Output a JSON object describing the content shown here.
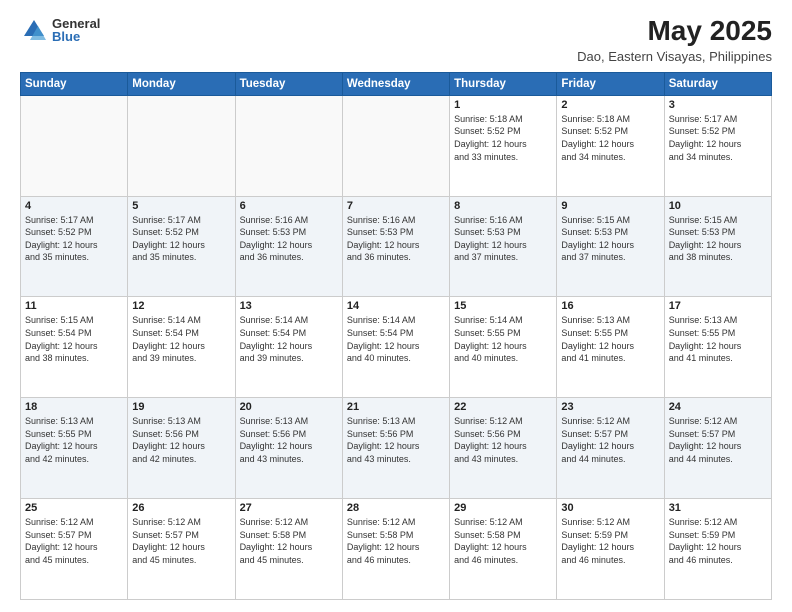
{
  "header": {
    "logo_general": "General",
    "logo_blue": "Blue",
    "title": "May 2025",
    "subtitle": "Dao, Eastern Visayas, Philippines"
  },
  "days_of_week": [
    "Sunday",
    "Monday",
    "Tuesday",
    "Wednesday",
    "Thursday",
    "Friday",
    "Saturday"
  ],
  "weeks": [
    [
      {
        "day": "",
        "info": ""
      },
      {
        "day": "",
        "info": ""
      },
      {
        "day": "",
        "info": ""
      },
      {
        "day": "",
        "info": ""
      },
      {
        "day": "1",
        "info": "Sunrise: 5:18 AM\nSunset: 5:52 PM\nDaylight: 12 hours\nand 33 minutes."
      },
      {
        "day": "2",
        "info": "Sunrise: 5:18 AM\nSunset: 5:52 PM\nDaylight: 12 hours\nand 34 minutes."
      },
      {
        "day": "3",
        "info": "Sunrise: 5:17 AM\nSunset: 5:52 PM\nDaylight: 12 hours\nand 34 minutes."
      }
    ],
    [
      {
        "day": "4",
        "info": "Sunrise: 5:17 AM\nSunset: 5:52 PM\nDaylight: 12 hours\nand 35 minutes."
      },
      {
        "day": "5",
        "info": "Sunrise: 5:17 AM\nSunset: 5:52 PM\nDaylight: 12 hours\nand 35 minutes."
      },
      {
        "day": "6",
        "info": "Sunrise: 5:16 AM\nSunset: 5:53 PM\nDaylight: 12 hours\nand 36 minutes."
      },
      {
        "day": "7",
        "info": "Sunrise: 5:16 AM\nSunset: 5:53 PM\nDaylight: 12 hours\nand 36 minutes."
      },
      {
        "day": "8",
        "info": "Sunrise: 5:16 AM\nSunset: 5:53 PM\nDaylight: 12 hours\nand 37 minutes."
      },
      {
        "day": "9",
        "info": "Sunrise: 5:15 AM\nSunset: 5:53 PM\nDaylight: 12 hours\nand 37 minutes."
      },
      {
        "day": "10",
        "info": "Sunrise: 5:15 AM\nSunset: 5:53 PM\nDaylight: 12 hours\nand 38 minutes."
      }
    ],
    [
      {
        "day": "11",
        "info": "Sunrise: 5:15 AM\nSunset: 5:54 PM\nDaylight: 12 hours\nand 38 minutes."
      },
      {
        "day": "12",
        "info": "Sunrise: 5:14 AM\nSunset: 5:54 PM\nDaylight: 12 hours\nand 39 minutes."
      },
      {
        "day": "13",
        "info": "Sunrise: 5:14 AM\nSunset: 5:54 PM\nDaylight: 12 hours\nand 39 minutes."
      },
      {
        "day": "14",
        "info": "Sunrise: 5:14 AM\nSunset: 5:54 PM\nDaylight: 12 hours\nand 40 minutes."
      },
      {
        "day": "15",
        "info": "Sunrise: 5:14 AM\nSunset: 5:55 PM\nDaylight: 12 hours\nand 40 minutes."
      },
      {
        "day": "16",
        "info": "Sunrise: 5:13 AM\nSunset: 5:55 PM\nDaylight: 12 hours\nand 41 minutes."
      },
      {
        "day": "17",
        "info": "Sunrise: 5:13 AM\nSunset: 5:55 PM\nDaylight: 12 hours\nand 41 minutes."
      }
    ],
    [
      {
        "day": "18",
        "info": "Sunrise: 5:13 AM\nSunset: 5:55 PM\nDaylight: 12 hours\nand 42 minutes."
      },
      {
        "day": "19",
        "info": "Sunrise: 5:13 AM\nSunset: 5:56 PM\nDaylight: 12 hours\nand 42 minutes."
      },
      {
        "day": "20",
        "info": "Sunrise: 5:13 AM\nSunset: 5:56 PM\nDaylight: 12 hours\nand 43 minutes."
      },
      {
        "day": "21",
        "info": "Sunrise: 5:13 AM\nSunset: 5:56 PM\nDaylight: 12 hours\nand 43 minutes."
      },
      {
        "day": "22",
        "info": "Sunrise: 5:12 AM\nSunset: 5:56 PM\nDaylight: 12 hours\nand 43 minutes."
      },
      {
        "day": "23",
        "info": "Sunrise: 5:12 AM\nSunset: 5:57 PM\nDaylight: 12 hours\nand 44 minutes."
      },
      {
        "day": "24",
        "info": "Sunrise: 5:12 AM\nSunset: 5:57 PM\nDaylight: 12 hours\nand 44 minutes."
      }
    ],
    [
      {
        "day": "25",
        "info": "Sunrise: 5:12 AM\nSunset: 5:57 PM\nDaylight: 12 hours\nand 45 minutes."
      },
      {
        "day": "26",
        "info": "Sunrise: 5:12 AM\nSunset: 5:57 PM\nDaylight: 12 hours\nand 45 minutes."
      },
      {
        "day": "27",
        "info": "Sunrise: 5:12 AM\nSunset: 5:58 PM\nDaylight: 12 hours\nand 45 minutes."
      },
      {
        "day": "28",
        "info": "Sunrise: 5:12 AM\nSunset: 5:58 PM\nDaylight: 12 hours\nand 46 minutes."
      },
      {
        "day": "29",
        "info": "Sunrise: 5:12 AM\nSunset: 5:58 PM\nDaylight: 12 hours\nand 46 minutes."
      },
      {
        "day": "30",
        "info": "Sunrise: 5:12 AM\nSunset: 5:59 PM\nDaylight: 12 hours\nand 46 minutes."
      },
      {
        "day": "31",
        "info": "Sunrise: 5:12 AM\nSunset: 5:59 PM\nDaylight: 12 hours\nand 46 minutes."
      }
    ]
  ]
}
